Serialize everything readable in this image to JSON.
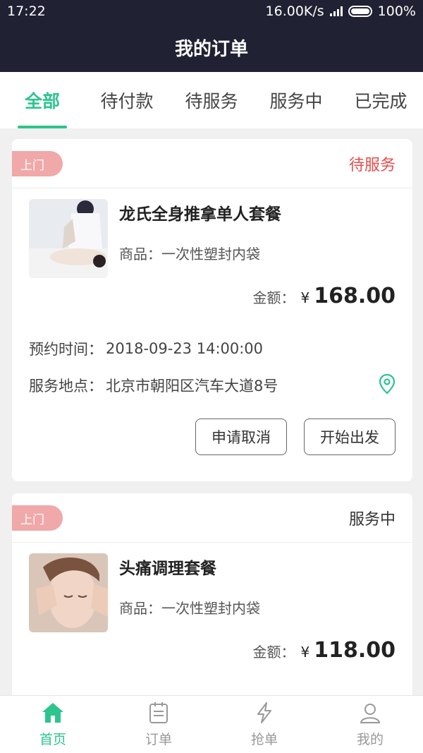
{
  "status_bar": {
    "time": "17:22",
    "network_speed": "16.00K/s",
    "battery": "100%",
    "battery_level": 1.0
  },
  "header": {
    "title": "我的订单"
  },
  "tabs": [
    {
      "label": "全部",
      "active": true
    },
    {
      "label": "待付款",
      "active": false
    },
    {
      "label": "待服务",
      "active": false
    },
    {
      "label": "服务中",
      "active": false
    },
    {
      "label": "已完成",
      "active": false
    }
  ],
  "orders": [
    {
      "tag": "上门",
      "status": "待服务",
      "title": "龙氏全身推拿单人套餐",
      "product": "商品：一次性塑封内袋",
      "amount_label": "金额：",
      "currency": "¥",
      "amount": "168.00",
      "appointment_label": "预约时间：",
      "appointment_time": "2018-09-23 14:00:00",
      "location_label": "服务地点：",
      "location": "北京市朝阳区汽车大道8号",
      "location_icon": "map-pin-icon",
      "actions": {
        "cancel": "申请取消",
        "depart": "开始出发"
      }
    },
    {
      "tag": "上门",
      "status": "服务中",
      "title": "头痛调理套餐",
      "product": "商品：一次性塑封内袋",
      "amount_label": "金额：",
      "currency": "¥",
      "amount": "118.00"
    }
  ],
  "bottom_nav": [
    {
      "label": "首页",
      "icon": "home-icon",
      "active": true
    },
    {
      "label": "订单",
      "icon": "clipboard-icon",
      "active": false
    },
    {
      "label": "抢单",
      "icon": "lightning-icon",
      "active": false
    },
    {
      "label": "我的",
      "icon": "user-icon",
      "active": false
    }
  ],
  "colors": {
    "accent": "#2cc58d",
    "header_bg": "#202233",
    "pending": "#e84c4c",
    "tag_bg": "#f0a8a8"
  }
}
